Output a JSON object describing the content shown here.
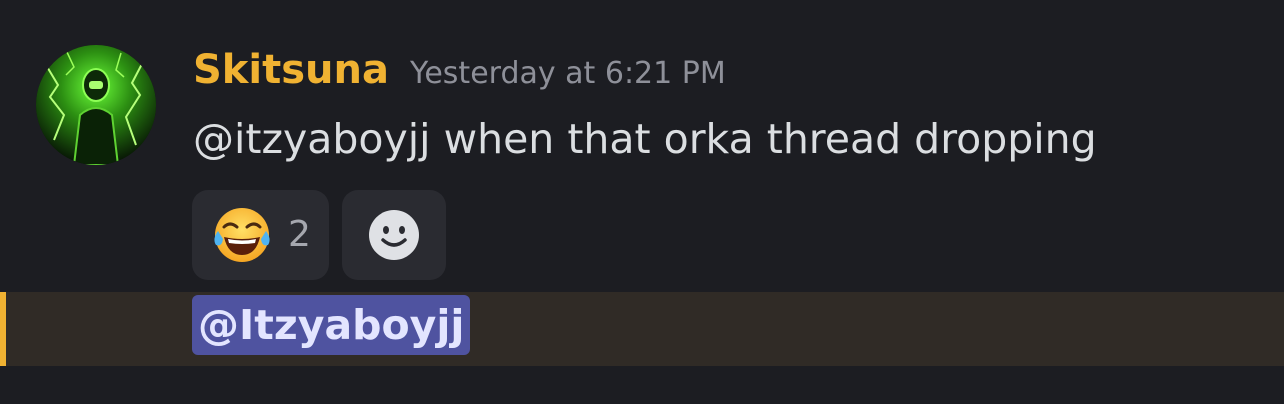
{
  "message": {
    "avatar_icon": "green-lightning-avatar-icon",
    "username": "Skitsuna",
    "username_color": "#f0b232",
    "timestamp": "Yesterday at 6:21 PM",
    "text": "@itzyaboyjj when that orka thread dropping"
  },
  "reactions": [
    {
      "icon": "laughing-tears-emoji-icon",
      "count": "2"
    }
  ],
  "add_reaction": {
    "icon": "smiley-face-icon"
  },
  "composer": {
    "mention": "@Itzyaboyjj",
    "accent_color": "#f0b232",
    "mention_bg": "#4f53a0"
  }
}
